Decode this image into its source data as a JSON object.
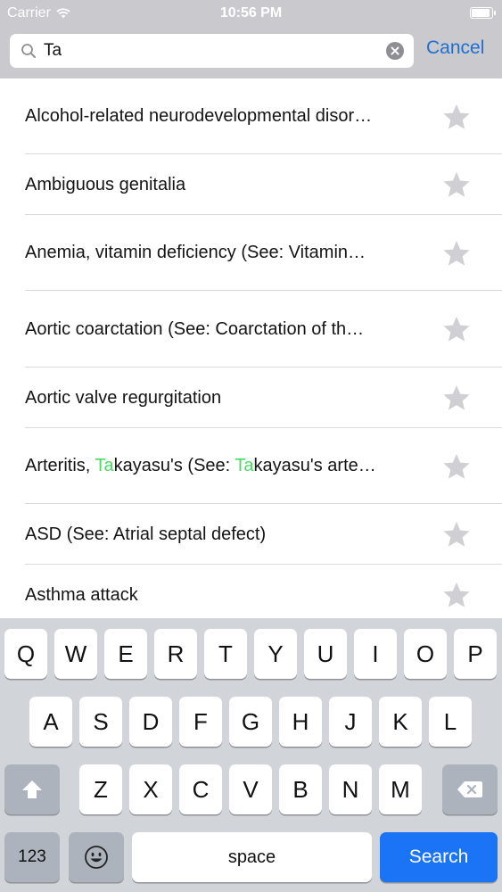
{
  "status_bar": {
    "carrier": "Carrier",
    "time": "10:56 PM",
    "battery_level": 0.95
  },
  "search": {
    "value": "Ta",
    "cancel_label": "Cancel"
  },
  "colors": {
    "accent": "#1f6fd1",
    "highlight": "#4cd964",
    "keyboard_search": "#1a74f5"
  },
  "results": [
    {
      "text": "Alcohol-related neurodevelopmental disor…"
    },
    {
      "text": "Ambiguous genitalia"
    },
    {
      "text": "Anemia, vitamin deficiency (See: Vitamin…"
    },
    {
      "text": "Aortic coarctation (See: Coarctation of th…"
    },
    {
      "text": "Aortic valve regurgitation"
    },
    {
      "pre": "Arteritis, ",
      "match1": "Ta",
      "mid": "kayasu's (See: ",
      "match2": "Ta",
      "post": "kayasu's arte…"
    },
    {
      "text": "ASD (See: Atrial septal defect)"
    },
    {
      "text": "Asthma attack"
    }
  ],
  "keyboard": {
    "row1": [
      "Q",
      "W",
      "E",
      "R",
      "T",
      "Y",
      "U",
      "I",
      "O",
      "P"
    ],
    "row2": [
      "A",
      "S",
      "D",
      "F",
      "G",
      "H",
      "J",
      "K",
      "L"
    ],
    "row3": [
      "Z",
      "X",
      "C",
      "V",
      "B",
      "N",
      "M"
    ],
    "numbers_label": "123",
    "space_label": "space",
    "search_label": "Search",
    "shift_icon": "shift-arrow-icon",
    "delete_icon": "backspace-icon",
    "emoji_icon": "emoji-icon"
  }
}
